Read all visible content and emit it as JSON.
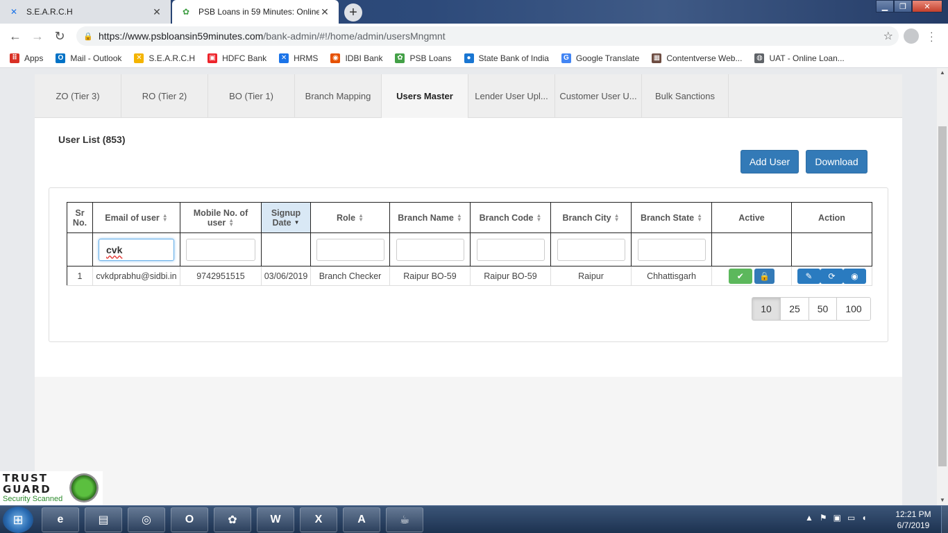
{
  "browser": {
    "tabs": [
      {
        "title": "S.E.A.R.C.H",
        "active": false
      },
      {
        "title": "PSB Loans in 59 Minutes: Online",
        "active": true
      }
    ],
    "url_host": "https://www.psbloansin59minutes.com",
    "url_path": "/bank-admin/#!/home/admin/usersMngmnt",
    "bookmarks": [
      {
        "label": "Apps",
        "icon": "apps-grid-icon",
        "color": "#d93025"
      },
      {
        "label": "Mail - Outlook",
        "icon": "outlook-icon",
        "color": "#0072c6"
      },
      {
        "label": "S.E.A.R.C.H",
        "icon": "search-logo-icon",
        "color": "#f4b400"
      },
      {
        "label": "HDFC Bank",
        "icon": "hdfc-icon",
        "color": "#ed232a"
      },
      {
        "label": "HRMS",
        "icon": "hrms-icon",
        "color": "#1a73e8"
      },
      {
        "label": "IDBI Bank",
        "icon": "idbi-icon",
        "color": "#e65100"
      },
      {
        "label": "PSB Loans",
        "icon": "psb-icon",
        "color": "#43a047"
      },
      {
        "label": "State Bank of India",
        "icon": "sbi-icon",
        "color": "#1976d2"
      },
      {
        "label": "Google Translate",
        "icon": "translate-icon",
        "color": "#4285f4"
      },
      {
        "label": "Contentverse Web...",
        "icon": "contentverse-icon",
        "color": "#6d4c41"
      },
      {
        "label": "UAT - Online Loan...",
        "icon": "globe-icon",
        "color": "#5f6368"
      }
    ]
  },
  "page_tabs": [
    {
      "label": "ZO (Tier 3)",
      "active": false
    },
    {
      "label": "RO (Tier 2)",
      "active": false
    },
    {
      "label": "BO (Tier 1)",
      "active": false
    },
    {
      "label": "Branch Mapping",
      "active": false
    },
    {
      "label": "Users Master",
      "active": true
    },
    {
      "label": "Lender User Upl...",
      "active": false
    },
    {
      "label": "Customer User U...",
      "active": false
    },
    {
      "label": "Bulk Sanctions",
      "active": false
    }
  ],
  "user_list": {
    "title": "User List (853)",
    "add_button": "Add User",
    "download_button": "Download",
    "columns": [
      {
        "label": "Sr No.",
        "sortable": false
      },
      {
        "label": "Email of user",
        "sortable": true
      },
      {
        "label": "Mobile No. of user",
        "sortable": true
      },
      {
        "label": "Signup Date",
        "sortable": true,
        "sorted": "desc"
      },
      {
        "label": "Role",
        "sortable": true
      },
      {
        "label": "Branch Name",
        "sortable": true
      },
      {
        "label": "Branch Code",
        "sortable": true
      },
      {
        "label": "Branch City",
        "sortable": true
      },
      {
        "label": "Branch State",
        "sortable": true
      },
      {
        "label": "Active",
        "sortable": false
      },
      {
        "label": "Action",
        "sortable": false
      }
    ],
    "filters": {
      "email": "cvk",
      "mobile": "",
      "role": "",
      "branch_name": "",
      "branch_code": "",
      "branch_city": "",
      "branch_state": ""
    },
    "rows": [
      {
        "sr": "1",
        "email": "cvkdprabhu@sidbi.in",
        "mobile": "9742951515",
        "signup_date": "03/06/2019",
        "role": "Branch Checker",
        "branch_name": "Raipur BO-59",
        "branch_code": "Raipur BO-59",
        "branch_city": "Raipur",
        "branch_state": "Chhattisgarh"
      }
    ],
    "page_sizes": [
      "10",
      "25",
      "50",
      "100"
    ],
    "selected_page_size": "10"
  },
  "trust_guard": {
    "line1": "TRUST",
    "line2": "GUARD",
    "line3": "Security Scanned"
  },
  "taskbar": {
    "time": "12:21 PM",
    "date": "6/7/2019",
    "apps": [
      "internet-explorer-icon",
      "file-explorer-icon",
      "chrome-icon",
      "outlook-icon",
      "psb-app-icon",
      "word-icon",
      "excel-icon",
      "acrobat-icon",
      "java-icon"
    ]
  },
  "colors": {
    "primary": "#337ab7",
    "success": "#5cb85c",
    "sorted_header": "#d9e8f5"
  }
}
